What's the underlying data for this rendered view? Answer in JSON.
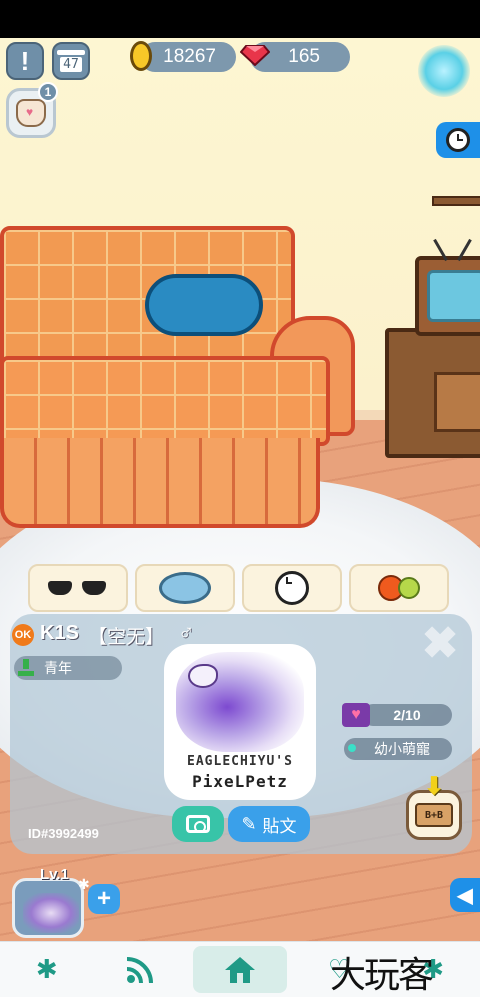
{
  "hud": {
    "calendar_day": "47",
    "coins": "18267",
    "gems": "165",
    "bag_badge": "1"
  },
  "actions": [
    {
      "name": "sunglasses"
    },
    {
      "name": "pet-bed"
    },
    {
      "name": "clock"
    },
    {
      "name": "fruit"
    }
  ],
  "pet": {
    "gender_badge": "OK",
    "name": "K1S",
    "mood": "【空无】",
    "sex_symbol": "♂",
    "stage": "青年",
    "affection": "2/10",
    "title": "幼小萌寵",
    "id": "ID#3992499",
    "card_brand_line1": "EAGLECHIYU'S",
    "card_brand_line2": "PixeLPetz",
    "post_label": "貼文",
    "breed_label": "B+B"
  },
  "level": {
    "label": "Lv.1"
  },
  "nav": {
    "items": [
      "paw-icon",
      "feed-icon",
      "home-icon",
      "heart-icon",
      "paw-print-icon"
    ],
    "active": "home-icon"
  },
  "watermark": "大玩客",
  "colors": {
    "accent_teal": "#1f9a86",
    "accent_blue": "#1e90e8",
    "panel": "#b0c6d6",
    "sofa": "#f29a52"
  }
}
